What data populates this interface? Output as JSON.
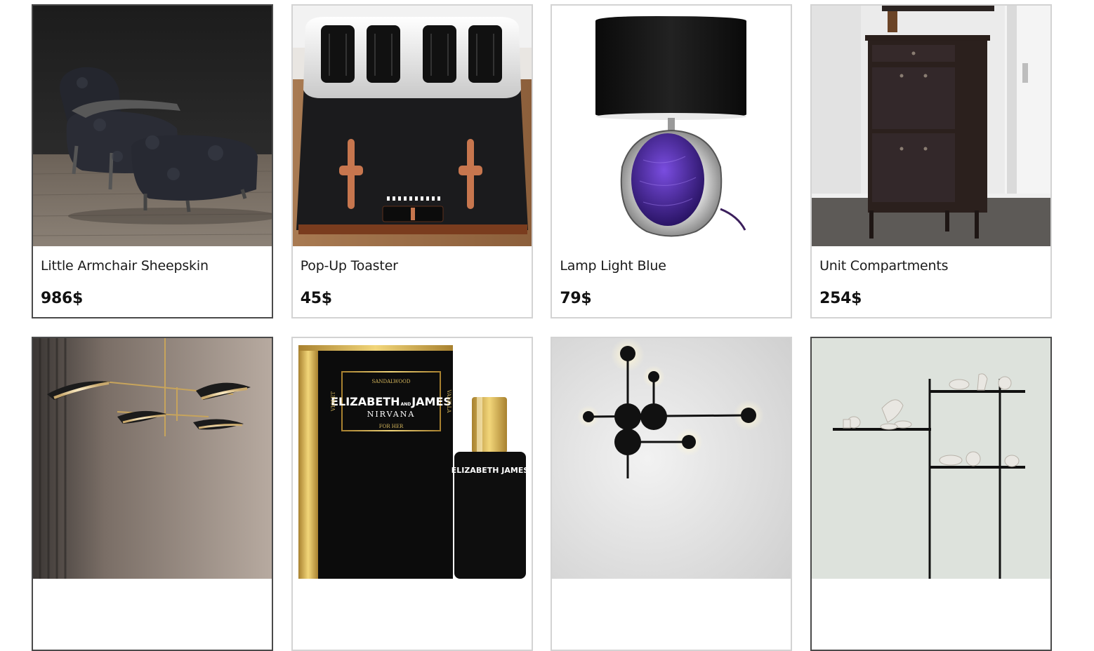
{
  "products": [
    {
      "name": "Little Armchair Sheepskin",
      "price": "986$",
      "image_icon": "sheepskin-armchair-image"
    },
    {
      "name": "Pop-Up Toaster",
      "price": "45$",
      "image_icon": "toaster-image"
    },
    {
      "name": "Lamp Light Blue",
      "price": "79$",
      "image_icon": "table-lamp-image"
    },
    {
      "name": "Unit Compartments",
      "price": "254$",
      "image_icon": "shoe-cabinet-image"
    },
    {
      "image_icon": "chandelier-image"
    },
    {
      "image_icon": "perfume-image",
      "text": {
        "brand": "ELIZABETH",
        "brand_amp": "AND",
        "brand_2": "JAMES",
        "line": "NIRVANA",
        "top": "SANDALWOOD",
        "bottom": "FOR HER",
        "left": "VIOLET",
        "right": "VANILLA",
        "bottle": "ELIZABETH JAMES"
      }
    },
    {
      "image_icon": "wall-lamp-image"
    },
    {
      "image_icon": "wall-shelf-image"
    }
  ]
}
